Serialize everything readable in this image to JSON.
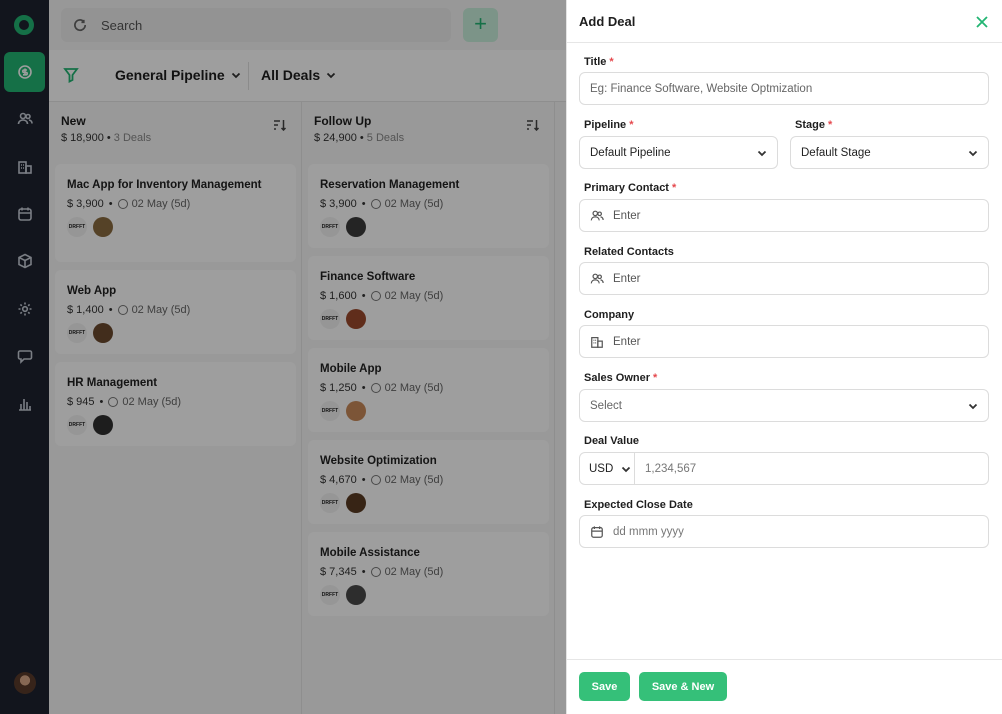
{
  "search": {
    "placeholder": "Search"
  },
  "header": {
    "add_label": "+"
  },
  "pipeline": {
    "name": "General Pipeline",
    "filter": "All Deals"
  },
  "columns": [
    {
      "name": "New",
      "amount": "$ 18,900",
      "count": "3 Deals",
      "cards": [
        {
          "title": "Mac App for Inventory Management",
          "value": "$ 3,900",
          "date": "02 May (5d)",
          "company": "DRFFT"
        },
        {
          "title": "Web App",
          "value": "$ 1,400",
          "date": "02 May (5d)",
          "company": "DRFFT"
        },
        {
          "title": "HR Management",
          "value": "$ 945",
          "date": "02 May (5d)",
          "company": "DRFFT"
        }
      ]
    },
    {
      "name": "Follow Up",
      "amount": "$ 24,900",
      "count": "5 Deals",
      "cards": [
        {
          "title": "Reservation Management",
          "value": "$ 3,900",
          "date": "02 May (5d)",
          "company": "DRFFT"
        },
        {
          "title": "Finance Software",
          "value": "$ 1,600",
          "date": "02 May (5d)",
          "company": "DRFFT"
        },
        {
          "title": "Mobile App",
          "value": "$ 1,250",
          "date": "02 May (5d)",
          "company": "DRFFT"
        },
        {
          "title": "Website Optimization",
          "value": "$ 4,670",
          "date": "02 May (5d)",
          "company": "DRFFT"
        },
        {
          "title": "Mobile Assistance",
          "value": "$ 7,345",
          "date": "02 May (5d)",
          "company": "DRFFT"
        }
      ]
    }
  ],
  "drawer": {
    "title": "Add Deal",
    "fields": {
      "title": {
        "label": "Title",
        "required": "*",
        "placeholder": "Eg: Finance Software, Website Optmization"
      },
      "pipeline": {
        "label": "Pipeline",
        "required": "*",
        "value": "Default Pipeline"
      },
      "stage": {
        "label": "Stage",
        "required": "*",
        "value": "Default Stage"
      },
      "primary_contact": {
        "label": "Primary Contact",
        "required": "*",
        "placeholder": "Enter"
      },
      "related_contacts": {
        "label": "Related Contacts",
        "placeholder": "Enter"
      },
      "company": {
        "label": "Company",
        "placeholder": "Enter"
      },
      "sales_owner": {
        "label": "Sales Owner",
        "required": "*",
        "placeholder": "Select"
      },
      "deal_value": {
        "label": "Deal Value",
        "currency": "USD",
        "placeholder": "1,234,567"
      },
      "close_date": {
        "label": "Expected Close Date",
        "placeholder": "dd mmm yyyy"
      }
    },
    "save_label": "Save",
    "save_new_label": "Save & New"
  },
  "colors": {
    "accent": "#22b573",
    "sidebar": "#1d2230",
    "required": "#e5484d"
  }
}
